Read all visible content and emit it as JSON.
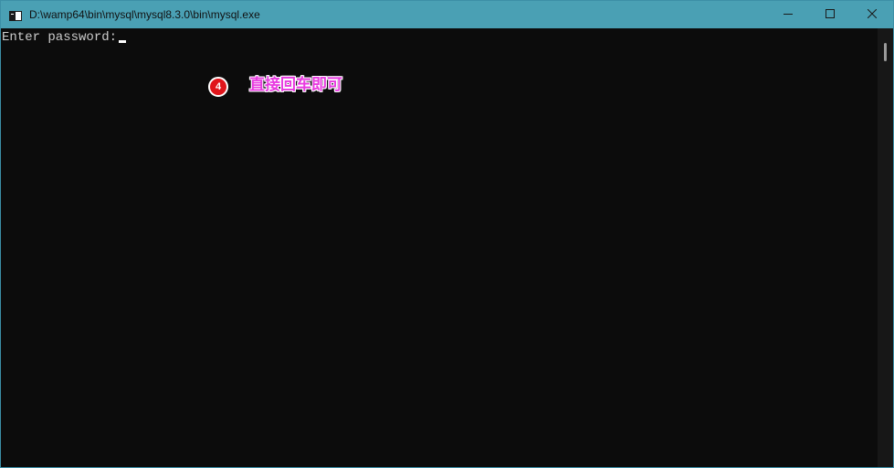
{
  "window": {
    "title": "D:\\wamp64\\bin\\mysql\\mysql8.3.0\\bin\\mysql.exe",
    "titlebar_color": "#4aa0b4",
    "buttons": {
      "minimize_icon": "minimize-icon",
      "maximize_icon": "maximize-icon",
      "close_icon": "close-icon"
    }
  },
  "console": {
    "background": "#0c0c0c",
    "lines": [
      "Enter password: "
    ]
  },
  "annotation": {
    "step_number": "4",
    "text": "直接回车即可",
    "text_color": "#e83ae0",
    "badge_color": "#e0151b"
  }
}
